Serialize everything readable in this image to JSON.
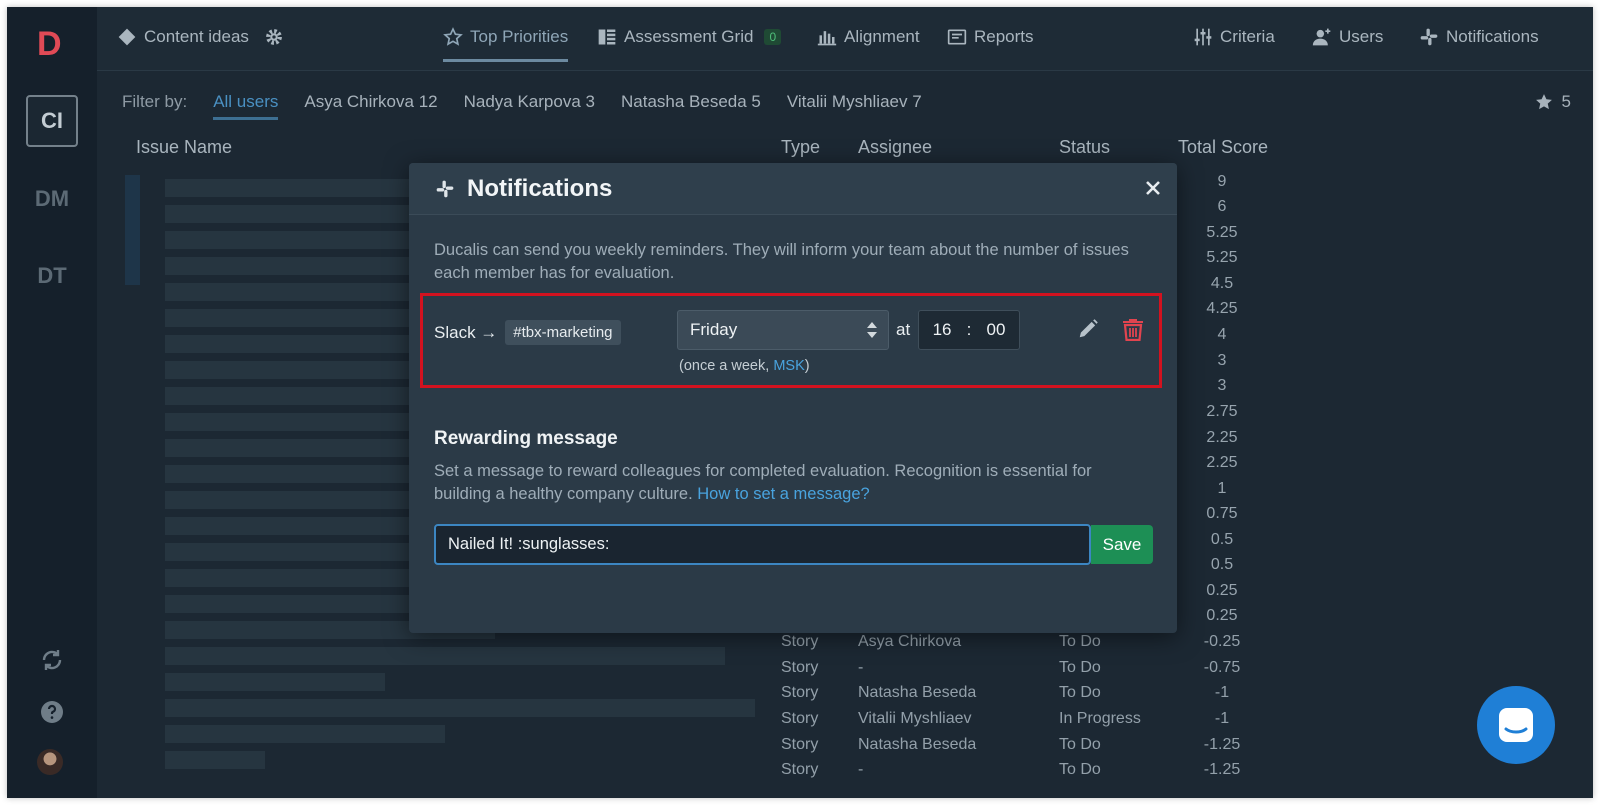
{
  "colors": {
    "accent_blue": "#49a3de",
    "danger_red": "#e1444f",
    "save_green": "#1d8f55",
    "highlight_red": "#d3121f"
  },
  "sidebar": {
    "logo_letter": "D",
    "workspaces": [
      {
        "label": "CI",
        "active": true
      },
      {
        "label": "DM"
      },
      {
        "label": "DT"
      }
    ],
    "icons": [
      "refresh-icon",
      "help-icon"
    ]
  },
  "topnav": {
    "project": "Content ideas",
    "tabs": [
      {
        "label": "Top Priorities",
        "icon": "star-icon",
        "active": true
      },
      {
        "label": "Assessment Grid",
        "icon": "grid-icon",
        "badge": "0"
      },
      {
        "label": "Alignment",
        "icon": "alignment-icon"
      },
      {
        "label": "Reports",
        "icon": "reports-icon"
      }
    ],
    "right": [
      {
        "label": "Criteria",
        "icon": "sliders-icon"
      },
      {
        "label": "Users",
        "icon": "add-user-icon"
      },
      {
        "label": "Notifications",
        "icon": "slack-icon"
      }
    ]
  },
  "filter": {
    "label": "Filter by:",
    "all": "All users",
    "users": [
      "Asya Chirkova 12",
      "Nadya Karpova 3",
      "Natasha Beseda 5",
      "Vitalii Myshliaev 7"
    ],
    "favorites": "5"
  },
  "table": {
    "headers": [
      "Issue Name",
      "Type",
      "Assignee",
      "Status",
      "Total Score"
    ],
    "scores": [
      "9",
      "6",
      "5.25",
      "5.25",
      "4.5",
      "4.25",
      "4",
      "3",
      "3",
      "2.75",
      "2.25",
      "2.25",
      "1",
      "0.75",
      "0.5",
      "0.5",
      "0.25",
      "0.25"
    ],
    "rows": [
      {
        "type": "Story",
        "assignee": "Asya Chirkova",
        "status": "To Do",
        "score": "-0.25"
      },
      {
        "type": "Story",
        "assignee": "-",
        "status": "To Do",
        "score": "-0.75"
      },
      {
        "type": "Story",
        "assignee": "Natasha Beseda",
        "status": "To Do",
        "score": "-1"
      },
      {
        "type": "Story",
        "assignee": "Vitalii Myshliaev",
        "status": "In Progress",
        "score": "-1"
      },
      {
        "type": "Story",
        "assignee": "Natasha Beseda",
        "status": "To Do",
        "score": "-1.25"
      },
      {
        "type": "Story",
        "assignee": "-",
        "status": "To Do",
        "score": "-1.25"
      }
    ]
  },
  "modal": {
    "title": "Notifications",
    "description": "Ducalis can send you weekly reminders. They will inform your team about the number of issues each member has for evaluation.",
    "reminder": {
      "service": "Slack →",
      "channel": "#tbx-marketing",
      "day": "Friday",
      "at": "at",
      "hour": "16",
      "separator": ":",
      "minute": "00",
      "frequency_prefix": "(once a week, ",
      "timezone": "MSK",
      "frequency_suffix": ")"
    },
    "reward": {
      "title": "Rewarding message",
      "description": "Set a message to reward colleagues for completed evaluation. Recognition is essential for building a healthy company culture.",
      "link": "How to set a message?",
      "value": "Nailed It! :sunglasses:",
      "save_label": "Save"
    }
  }
}
